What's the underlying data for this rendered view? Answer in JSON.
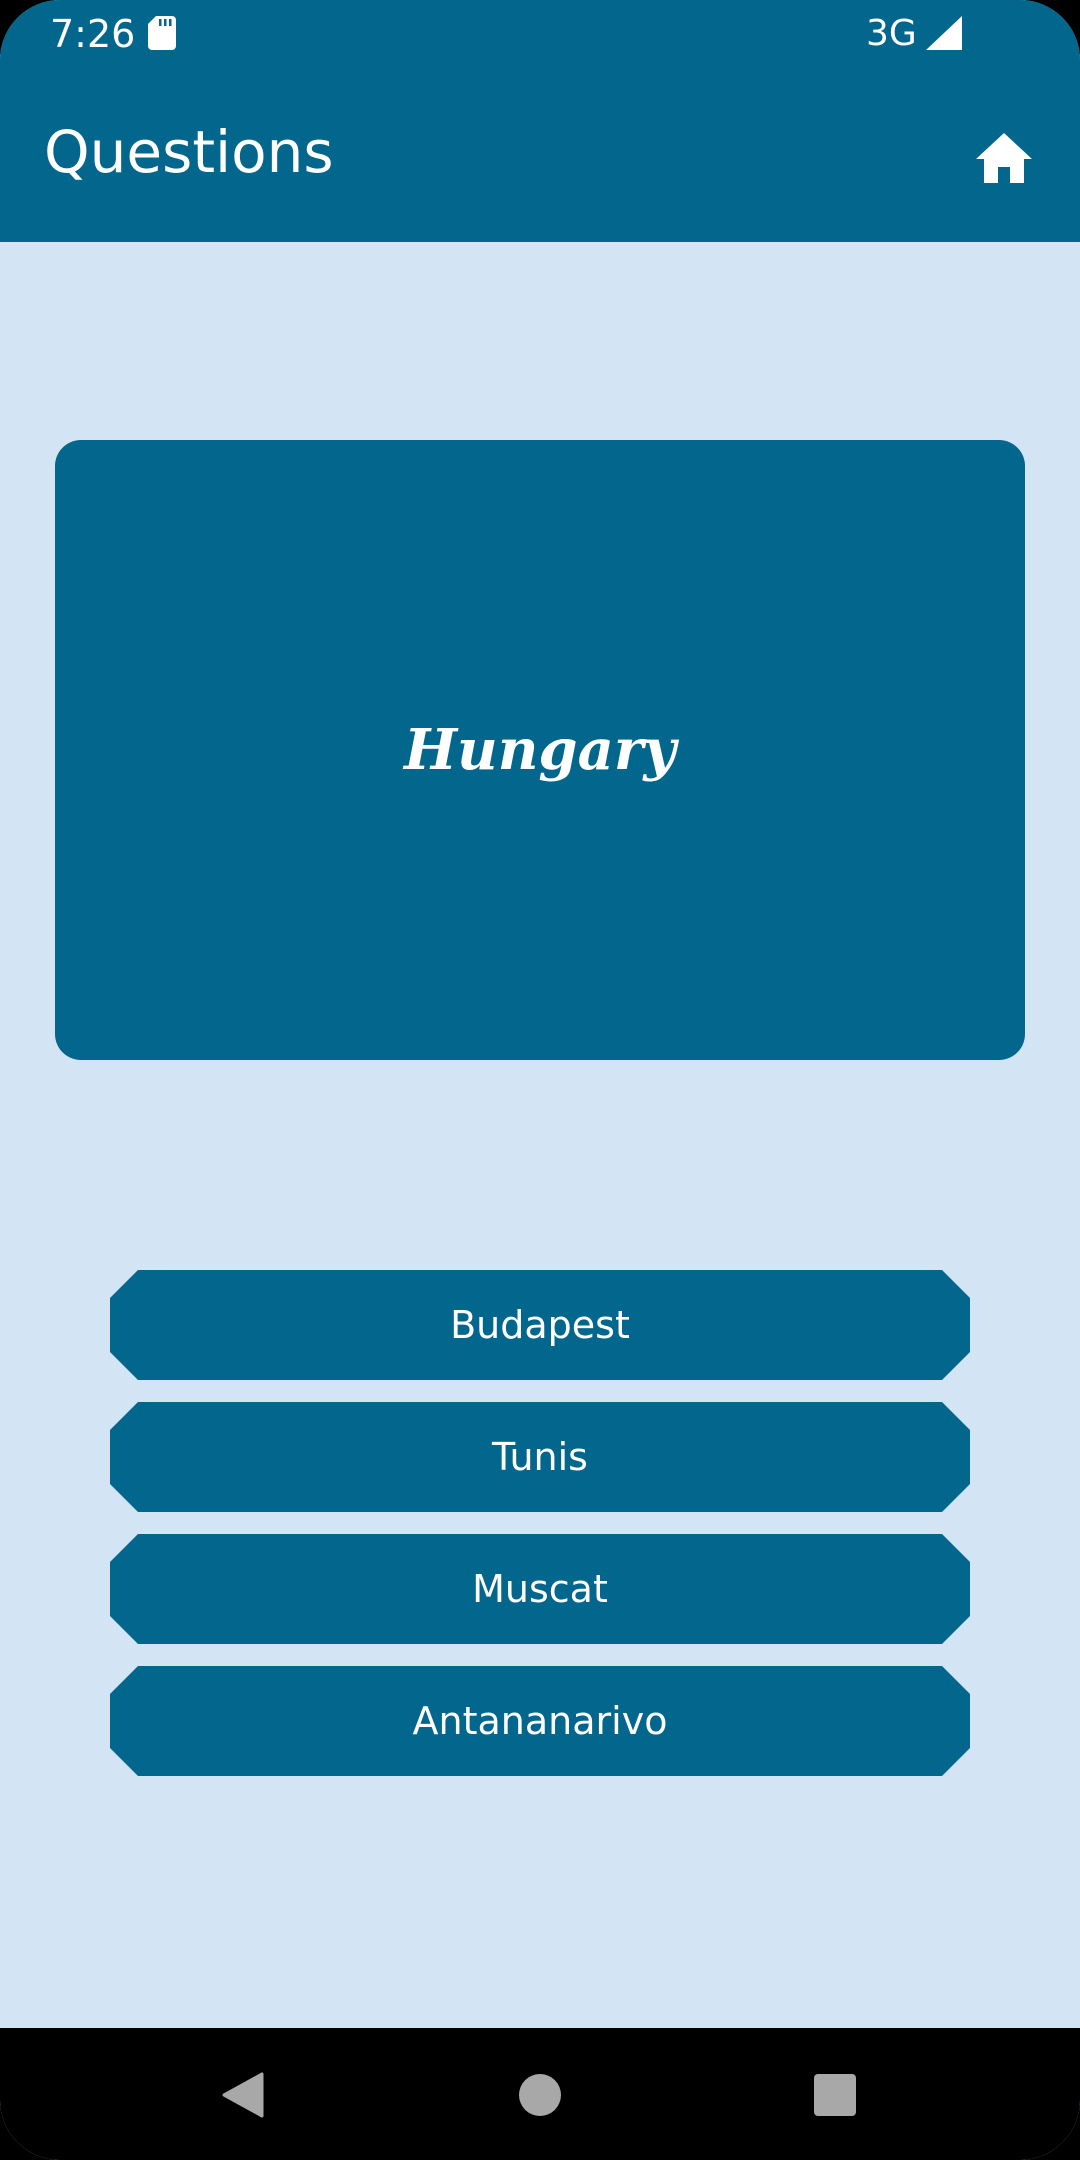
{
  "status_bar": {
    "time": "7:26",
    "network": "3G",
    "icons": [
      "sd-card-icon",
      "cell-signal-icon"
    ]
  },
  "app_bar": {
    "title": "Questions",
    "home_icon": "home-icon"
  },
  "question": {
    "country": "Hungary"
  },
  "answers": [
    {
      "label": "Budapest"
    },
    {
      "label": "Tunis"
    },
    {
      "label": "Muscat"
    },
    {
      "label": "Antananarivo"
    }
  ],
  "nav_bar": {
    "icons": [
      "back-icon",
      "home-circle-icon",
      "recents-icon"
    ]
  },
  "colors": {
    "primary": "#03668c",
    "background": "#d3e5f4",
    "nav_background": "#000000",
    "on_primary": "#ffffff"
  }
}
